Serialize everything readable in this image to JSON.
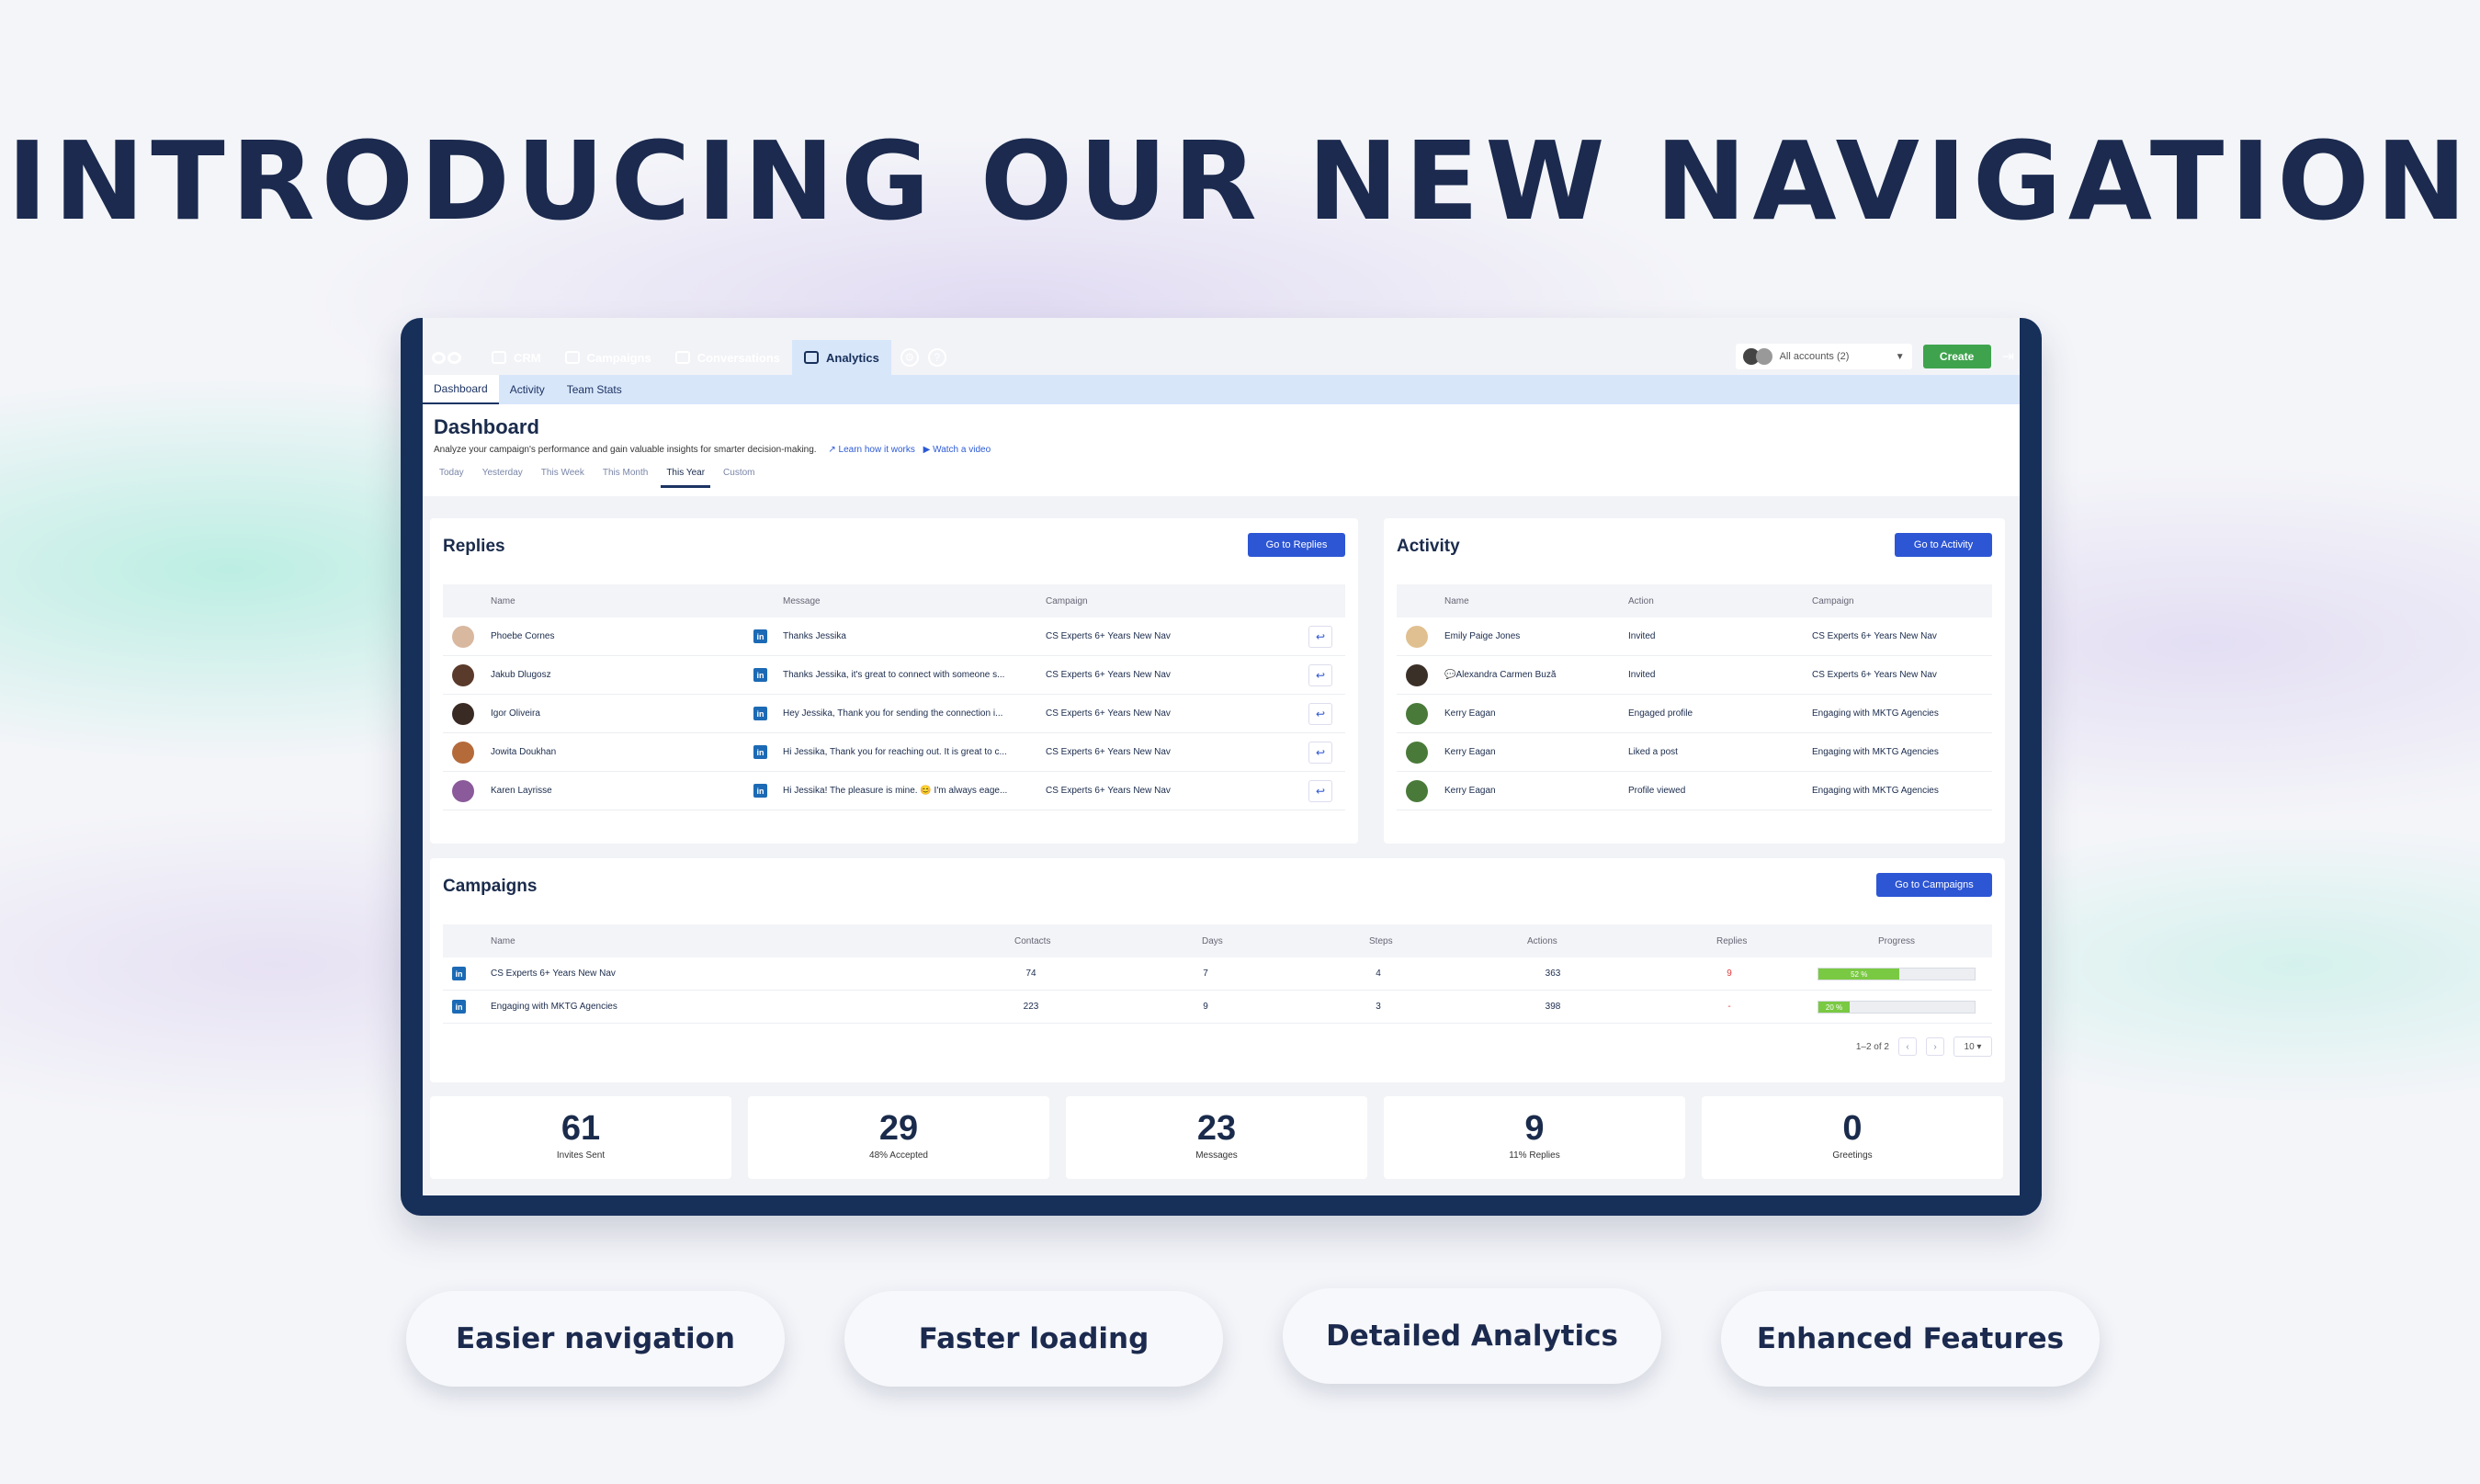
{
  "headline": "INTRODUCING OUR NEW NAVIGATION",
  "topnav": {
    "items": [
      {
        "label": "CRM",
        "icon": "contact-card-icon"
      },
      {
        "label": "Campaigns",
        "icon": "envelope-icon"
      },
      {
        "label": "Conversations",
        "icon": "chat-icon"
      },
      {
        "label": "Analytics",
        "icon": "bar-chart-icon",
        "active": true
      }
    ],
    "account_selector": "All accounts (2)",
    "create_label": "Create",
    "settings_icon": "gear-icon",
    "help_icon": "question-icon",
    "help_glyph": "?",
    "logout_icon": "logout-icon"
  },
  "subtabs": [
    {
      "label": "Dashboard",
      "active": true
    },
    {
      "label": "Activity"
    },
    {
      "label": "Team Stats"
    }
  ],
  "dashboard": {
    "title": "Dashboard",
    "subtitle": "Analyze your campaign's performance and gain valuable insights for smarter decision-making.",
    "learn_link": "Learn how it works",
    "video_link": "Watch a video",
    "periods": [
      "Today",
      "Yesterday",
      "This Week",
      "This Month",
      "This Year",
      "Custom"
    ],
    "active_period": "This Year"
  },
  "replies": {
    "title": "Replies",
    "button": "Go to Replies",
    "columns": [
      "Name",
      "Message",
      "Campaign"
    ],
    "rows": [
      {
        "name": "Phoebe Cornes",
        "message": "Thanks Jessika",
        "campaign": "CS Experts 6+ Years New Nav",
        "avatar_color": "#d9b8a0"
      },
      {
        "name": "Jakub Dlugosz",
        "message": "Thanks Jessika, it's great to connect with someone s...",
        "campaign": "CS Experts 6+ Years New Nav",
        "avatar_color": "#5a3a2a"
      },
      {
        "name": "Igor Oliveira",
        "message": "Hey Jessika, Thank you for sending the connection i...",
        "campaign": "CS Experts 6+ Years New Nav",
        "avatar_color": "#3a2a24"
      },
      {
        "name": "Jowita Doukhan",
        "message": "Hi Jessika, Thank you for reaching out. It is great to c...",
        "campaign": "CS Experts 6+ Years New Nav",
        "avatar_color": "#b56a3a"
      },
      {
        "name": "Karen Layrisse",
        "message": "Hi Jessika! The pleasure is mine. 😊 I'm always eage...",
        "campaign": "CS Experts 6+ Years New Nav",
        "avatar_color": "#8a5a9a"
      }
    ]
  },
  "activity": {
    "title": "Activity",
    "button": "Go to Activity",
    "columns": [
      "Name",
      "Action",
      "Campaign"
    ],
    "rows": [
      {
        "name": "Emily Paige Jones",
        "action": "Invited",
        "campaign": "CS Experts 6+ Years New Nav",
        "avatar_color": "#e0c090"
      },
      {
        "name": "💬Alexandra Carmen Buză",
        "action": "Invited",
        "campaign": "CS Experts 6+ Years New Nav",
        "avatar_color": "#3a3028"
      },
      {
        "name": "Kerry Eagan",
        "action": "Engaged profile",
        "campaign": "Engaging with MKTG Agencies",
        "avatar_color": "#4a7a3a"
      },
      {
        "name": "Kerry Eagan",
        "action": "Liked a post",
        "campaign": "Engaging with MKTG Agencies",
        "avatar_color": "#4a7a3a"
      },
      {
        "name": "Kerry Eagan",
        "action": "Profile viewed",
        "campaign": "Engaging with MKTG Agencies",
        "avatar_color": "#4a7a3a"
      }
    ]
  },
  "campaigns": {
    "title": "Campaigns",
    "button": "Go to Campaigns",
    "columns": [
      "Name",
      "Contacts",
      "Days",
      "Steps",
      "Actions",
      "Replies",
      "Progress"
    ],
    "rows": [
      {
        "name": "CS Experts 6+ Years New Nav",
        "contacts": "74",
        "days": "7",
        "steps": "4",
        "actions": "363",
        "replies": "9",
        "progress": 52,
        "progress_label": "52 %"
      },
      {
        "name": "Engaging with MKTG Agencies",
        "contacts": "223",
        "days": "9",
        "steps": "3",
        "actions": "398",
        "replies": "-",
        "progress": 20,
        "progress_label": "20 %"
      }
    ],
    "pagination": "1–2 of 2",
    "page_size": "10"
  },
  "stats": [
    {
      "value": "61",
      "label": "Invites Sent"
    },
    {
      "value": "29",
      "label": "48% Accepted"
    },
    {
      "value": "23",
      "label": "Messages"
    },
    {
      "value": "9",
      "label": "11% Replies"
    },
    {
      "value": "0",
      "label": "Greetings"
    }
  ],
  "features": [
    "Easier navigation",
    "Faster loading",
    "Detailed Analytics",
    "Enhanced Features"
  ],
  "colors": {
    "navy": "#17305a",
    "accent": "#2d56d4",
    "create": "#3fa34d",
    "progress": "#7ac943",
    "reply_count": "#e03a3a"
  }
}
